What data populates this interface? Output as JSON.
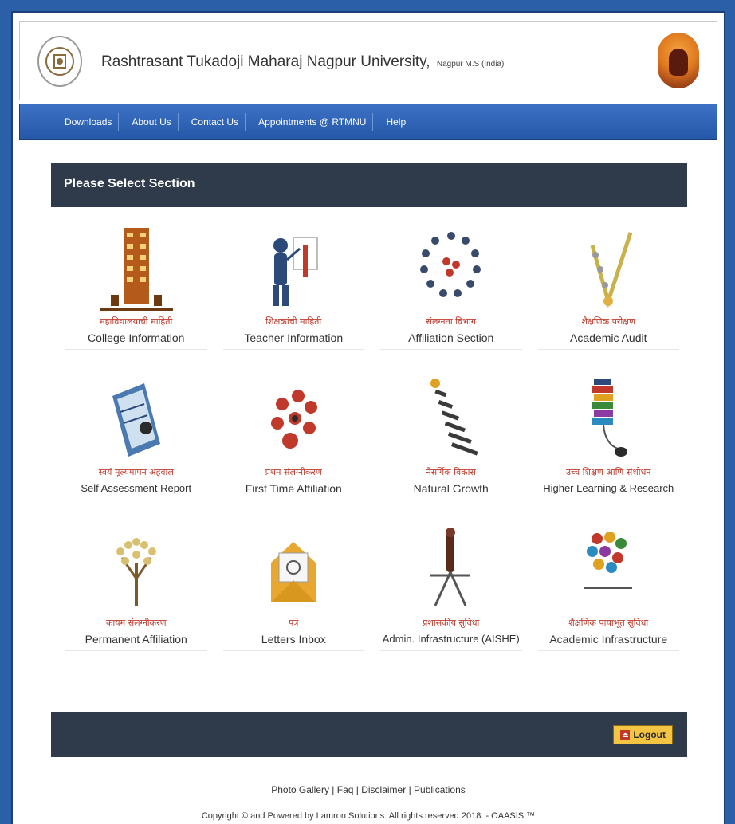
{
  "header": {
    "university_name": "Rashtrasant Tukadoji Maharaj Nagpur University,",
    "location": "Nagpur M.S (India)"
  },
  "nav": {
    "items": [
      "Downloads",
      "About Us",
      "Contact Us",
      "Appointments @ RTMNU",
      "Help"
    ]
  },
  "section": {
    "title": "Please Select Section"
  },
  "tiles": [
    {
      "marathi": "महाविद्यालयाची माहिती",
      "label": "College Information",
      "icon": "college-building-icon"
    },
    {
      "marathi": "शिक्षकांची माहिती",
      "label": "Teacher Information",
      "icon": "teacher-icon"
    },
    {
      "marathi": "संलग्नता विभाग",
      "label": "Affiliation Section",
      "icon": "affiliation-icon"
    },
    {
      "marathi": "शैक्षणिक परीक्षण",
      "label": "Academic Audit",
      "icon": "academic-audit-icon"
    },
    {
      "marathi": "स्वयं मूल्यमापन अहवाल",
      "label": "Self Assessment Report",
      "icon": "self-assessment-icon"
    },
    {
      "marathi": "प्रथम संलग्नीकरण",
      "label": "First Time Affiliation",
      "icon": "first-time-affiliation-icon"
    },
    {
      "marathi": "नैसर्गिक विकास",
      "label": "Natural Growth",
      "icon": "natural-growth-icon"
    },
    {
      "marathi": "उच्च शिक्षण आणि संशोधन",
      "label": "Higher Learning & Research",
      "icon": "higher-learning-icon"
    },
    {
      "marathi": "कायम संलग्नीकरण",
      "label": "Permanent Affiliation",
      "icon": "permanent-affiliation-icon"
    },
    {
      "marathi": "पत्रे",
      "label": "Letters Inbox",
      "icon": "letters-inbox-icon"
    },
    {
      "marathi": "प्रशासकीय सुविधा",
      "label": "Admin. Infrastructure (AISHE)",
      "icon": "admin-infrastructure-icon"
    },
    {
      "marathi": "शैक्षणिक पायाभूत सुविधा",
      "label": "Academic Infrastructure",
      "icon": "academic-infrastructure-icon"
    }
  ],
  "logout": {
    "label": "Logout"
  },
  "footer": {
    "links": [
      "Photo Gallery",
      "Faq",
      "Disclaimer",
      "Publications"
    ],
    "copyright": "Copyright © and Powered by Lamron Solutions. All rights reserved 2018. - OAASIS ™"
  },
  "colors": {
    "page_background": "#2b5fa8",
    "navbar": "#2f65b8",
    "section_bar": "#2f3a4a",
    "marathi_text": "#c0392b",
    "logout_button": "#f4c542"
  }
}
